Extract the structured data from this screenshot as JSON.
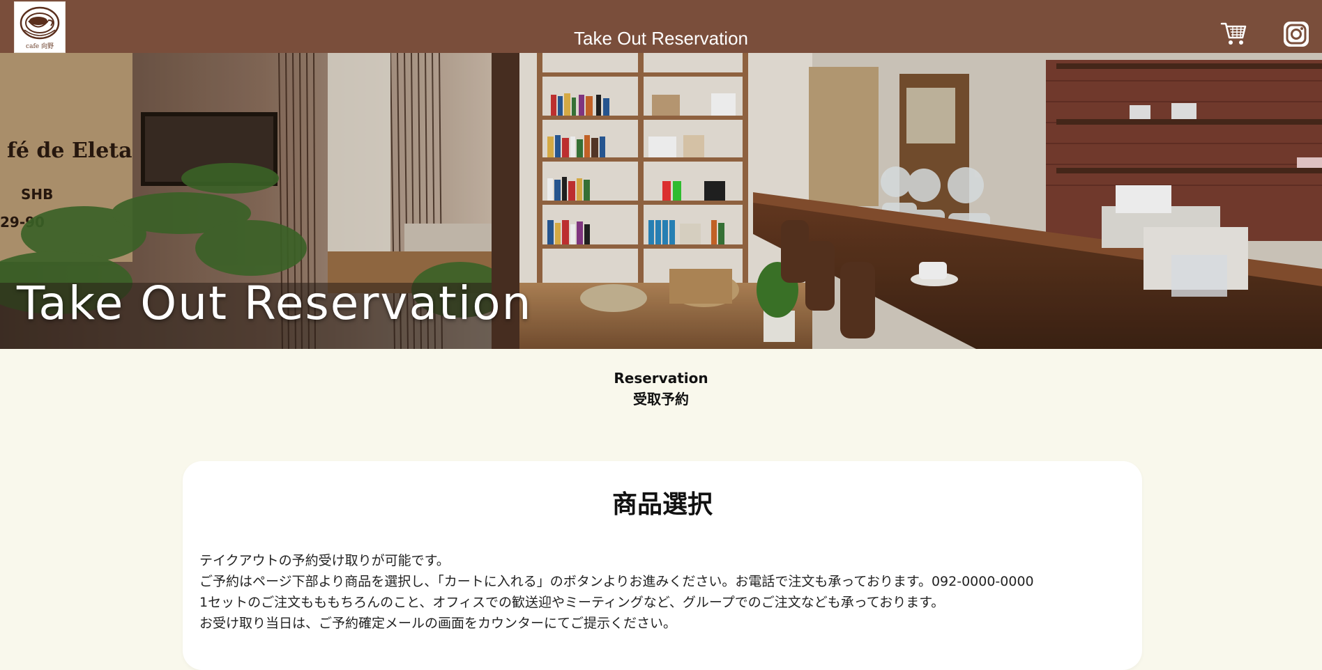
{
  "header": {
    "title": "Take Out Reservation",
    "logo_text": "cafe 向野",
    "background_color": "#7a4e3b",
    "icons": [
      "cart-icon",
      "instagram-icon"
    ]
  },
  "hero": {
    "title": "Take Out Reservation",
    "image_description_icon": "cafe-interior-photo"
  },
  "section": {
    "title_en": "Reservation",
    "title_ja": "受取予約"
  },
  "card": {
    "heading": "商品選択",
    "lines": [
      "テイクアウトの予約受け取りが可能です。",
      "ご予約はページ下部より商品を選択し、「カートに入れる」のボタンよりお進みください。お電話で注文も承っております。092-0000-0000",
      "1セットのご注文もももちろんのこと、オフィスでの歓送迎やミーティングなど、グループでのご注文なども承っております。",
      "お受け取り当日は、ご予約確定メールの画面をカウンターにてご提示ください。"
    ]
  },
  "colors": {
    "page_background": "#f9f8ec",
    "card_background": "#ffffff"
  }
}
